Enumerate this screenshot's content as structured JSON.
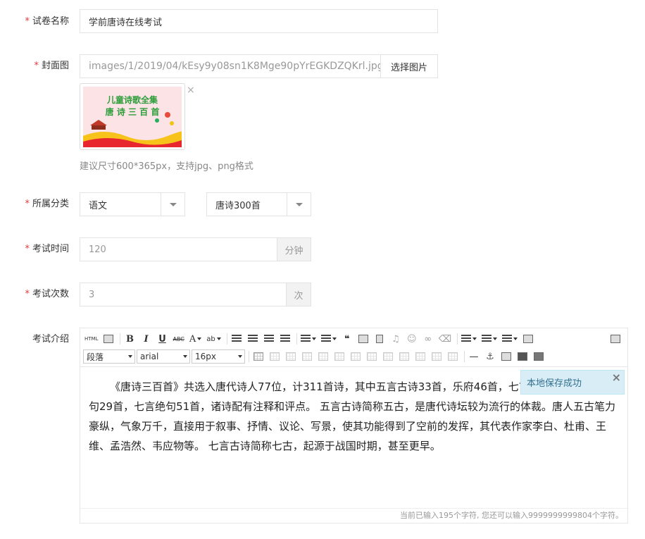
{
  "form": {
    "title": {
      "label": "试卷名称",
      "value": "学前唐诗在线考试"
    },
    "cover": {
      "label": "封面图",
      "value": "images/1/2019/04/kEsy9y08sn1K8Mge90pYrEGKDZQKrl.jpg",
      "button": "选择图片",
      "hint": "建议尺寸600*365px，支持jpg、png格式",
      "image_text_1": "儿童诗歌全集",
      "image_text_2": "唐 诗 三 百 首",
      "close": "×"
    },
    "category": {
      "label": "所属分类",
      "primary": "语文",
      "secondary": "唐诗300首"
    },
    "duration": {
      "label": "考试时间",
      "value": "120",
      "unit": "分钟"
    },
    "attempts": {
      "label": "考试次数",
      "value": "3",
      "unit": "次"
    },
    "intro": {
      "label": "考试介绍",
      "content": "《唐诗三百首》共选入唐代诗人77位，计311首诗，其中五言古诗33首，乐府46首，七言律诗50首，五言绝句29首，七言绝句51首，诸诗配有注释和评点。 五言古诗简称五古，是唐代诗坛较为流行的体裁。唐人五古笔力豪纵，气象万千，直接用于叙事、抒情、议论、写景，使其功能得到了空前的发挥，其代表作家李白、杜甫、王维、孟浩然、韦应物等。 七言古诗简称七古，起源于战国时期，甚至更早。",
      "counter": "当前已输入195个字符, 您还可以输入9999999999804个字符。",
      "toast": "本地保存成功",
      "toast_close": "×"
    }
  },
  "required_mark": "*",
  "toolbar": {
    "html": "HTML",
    "bold": "B",
    "italic": "I",
    "underline": "U",
    "strike": "ABC",
    "fontcolor": "A",
    "quote": "❝",
    "paragraph": "段落",
    "font": "arial",
    "size": "16px"
  },
  "colors": {
    "required": "#e4393c",
    "toast_bg": "#d9edf7",
    "toast_text": "#31708f"
  }
}
